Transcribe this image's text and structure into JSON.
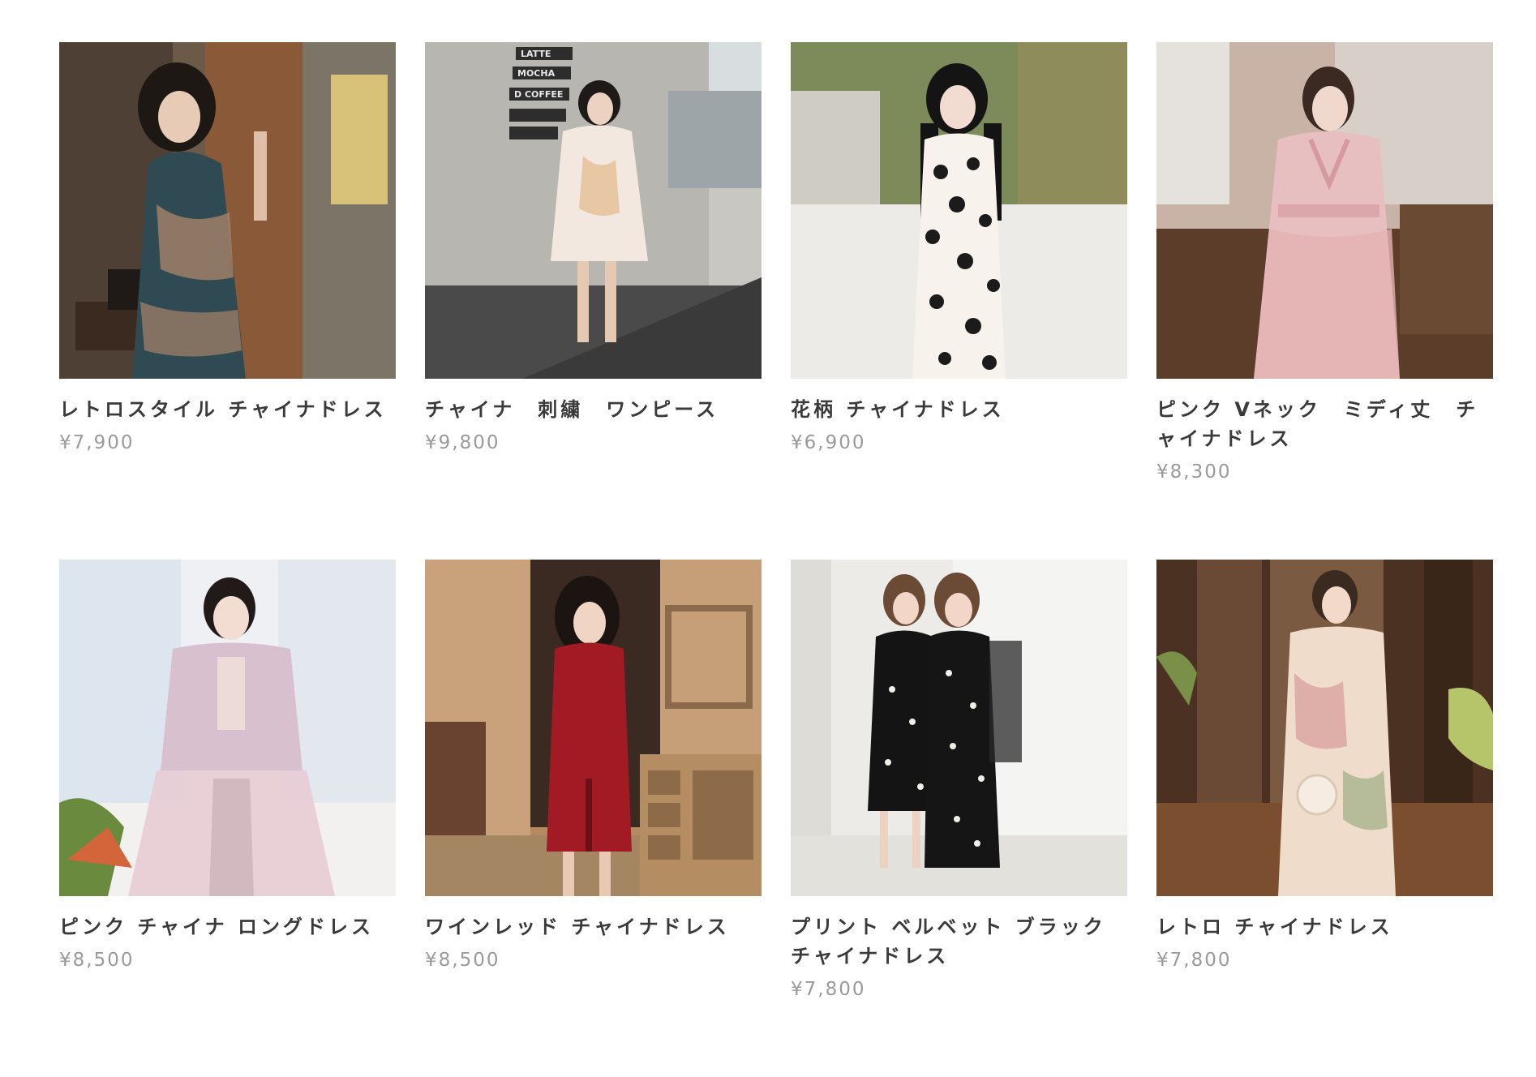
{
  "products": [
    {
      "name": "レトロスタイル チャイナドレス",
      "price": "¥7,900",
      "image": "retro-teal-floral-qipao-photo"
    },
    {
      "name": "チャイナ　刺繍　ワンピース",
      "price": "¥9,800",
      "image": "white-embroidered-dress-photo",
      "sign_text": [
        "LATTE",
        "MOCHA",
        "D COFFEE"
      ]
    },
    {
      "name": "花柄 チャイナドレス",
      "price": "¥6,900",
      "image": "black-white-floral-qipao-photo"
    },
    {
      "name": "ピンク Vネック　ミディ丈　チャイナドレス",
      "price": "¥8,300",
      "image": "pink-vneck-lace-dress-photo"
    },
    {
      "name": "ピンク チャイナ ロングドレス",
      "price": "¥8,500",
      "image": "pink-long-chinese-dress-photo"
    },
    {
      "name": "ワインレッド チャイナドレス",
      "price": "¥8,500",
      "image": "wine-red-qipao-photo"
    },
    {
      "name": "プリント ベルベット ブラック チャイナドレス",
      "price": "¥7,800",
      "image": "black-velvet-print-qipao-photo"
    },
    {
      "name": "レトロ チャイナドレス",
      "price": "¥7,800",
      "image": "retro-cream-floral-qipao-photo"
    }
  ]
}
